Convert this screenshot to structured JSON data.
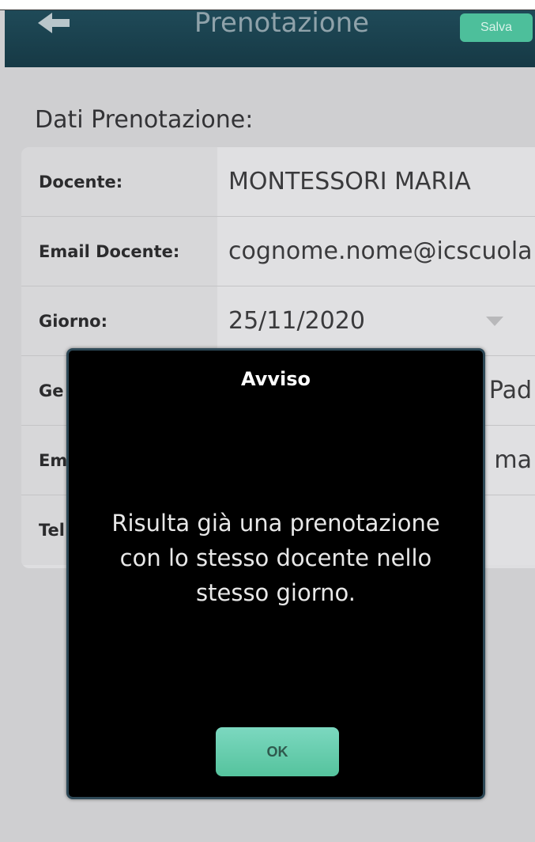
{
  "header": {
    "title": "Prenotazione",
    "back_icon": "arrow-left-icon",
    "save_label": "Salva"
  },
  "form": {
    "section_title": "Dati Prenotazione:",
    "rows": [
      {
        "label": "Docente:",
        "value": "MONTESSORI MARIA"
      },
      {
        "label": "Email Docente:",
        "value": "cognome.nome@icscuola"
      },
      {
        "label": "Giorno:",
        "value": "25/11/2020"
      },
      {
        "label": "Ge",
        "value": "Pad"
      },
      {
        "label": "Em",
        "value": "ma"
      },
      {
        "label": "Tel",
        "value": ""
      }
    ]
  },
  "dialog": {
    "title": "Avviso",
    "message": "Risulta già una prenotazione con lo stesso docente nello stesso giorno.",
    "ok_label": "OK"
  },
  "colors": {
    "header_bg": "#1a4250",
    "accent": "#4dbf9b",
    "dialog_bg": "#000000",
    "overlay": "#cfcfd1"
  }
}
